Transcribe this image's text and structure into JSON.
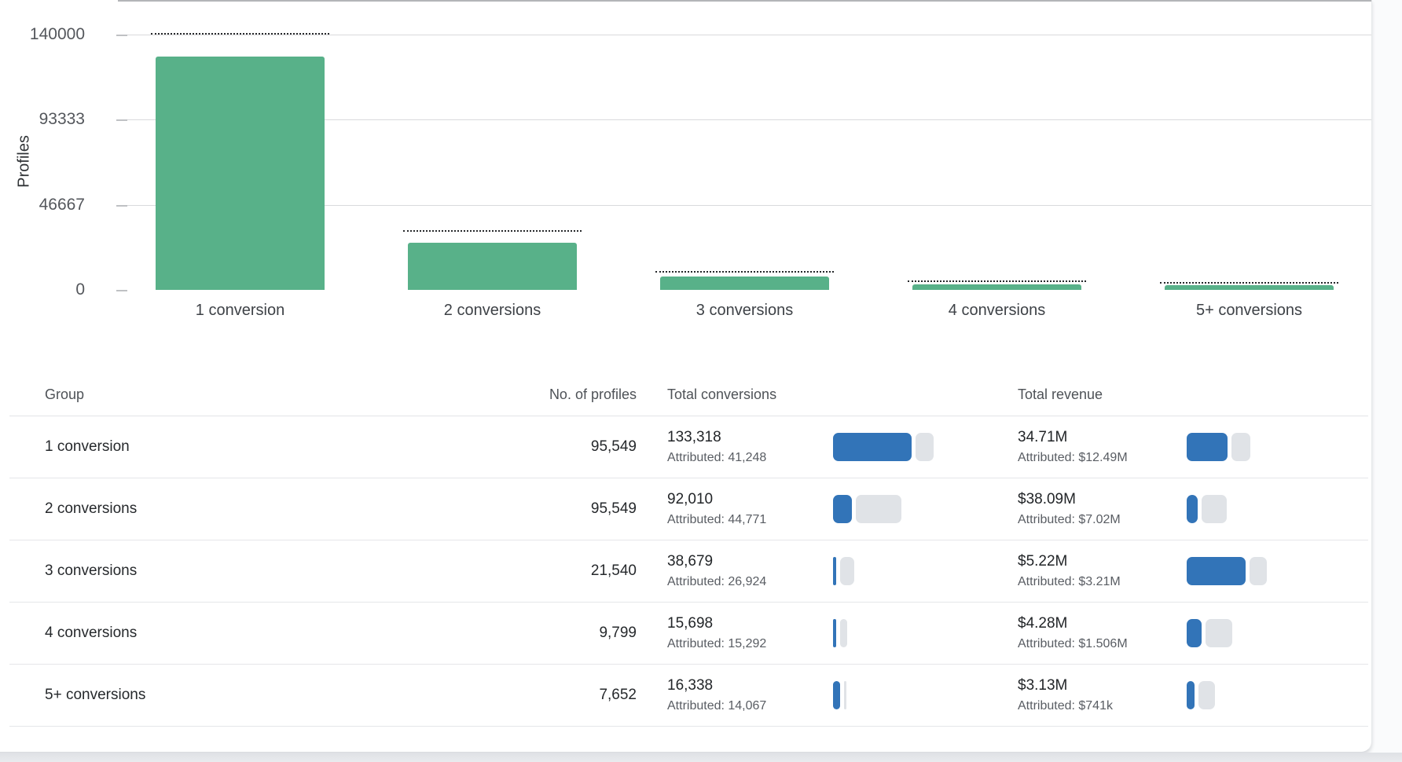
{
  "chart_data": {
    "type": "bar",
    "title": "",
    "xlabel": "",
    "ylabel": "Profiles",
    "categories": [
      "1 conversion",
      "2 conversions",
      "3 conversions",
      "4 conversions",
      "5+ conversions"
    ],
    "series": [
      {
        "name": "profiles-bar",
        "values": [
          128000,
          26000,
          7400,
          3000,
          2600
        ]
      },
      {
        "name": "dotted-benchmark",
        "values": [
          140000,
          32000,
          9500,
          4300,
          3500
        ]
      }
    ],
    "yticks": [
      140000,
      93333,
      46667,
      0
    ],
    "ytick_labels": [
      "140000",
      "93333",
      "46667",
      "0"
    ],
    "ylim": [
      0,
      140000
    ],
    "grid": "horizontal",
    "legend": "none",
    "bar_color": "#58b189",
    "dotted_color": "#26282b"
  },
  "table": {
    "headers": {
      "group": "Group",
      "profiles": "No. of profiles",
      "conversions": "Total conversions",
      "revenue": "Total revenue"
    },
    "rows": [
      {
        "group": "1 conversion",
        "profiles": "95,549",
        "conv_total": "133,318",
        "conv_attr": "Attributed: 41,248",
        "conv_bar": [
          100,
          23
        ],
        "rev_total": "34.71M",
        "rev_attr": "Attributed: $12.49M",
        "rev_bar": [
          52,
          24
        ]
      },
      {
        "group": "2 conversions",
        "profiles": "95,549",
        "conv_total": "92,010",
        "conv_attr": "Attributed: 44,771",
        "conv_bar": [
          24,
          58
        ],
        "rev_total": "$38.09M",
        "rev_attr": "Attributed: $7.02M",
        "rev_bar": [
          14,
          32
        ]
      },
      {
        "group": "3 conversions",
        "profiles": "21,540",
        "conv_total": "38,679",
        "conv_attr": "Attributed: 26,924",
        "conv_bar": [
          4,
          18
        ],
        "rev_total": "$5.22M",
        "rev_attr": "Attributed: $3.21M",
        "rev_bar": [
          75,
          22
        ]
      },
      {
        "group": "4 conversions",
        "profiles": "9,799",
        "conv_total": "15,698",
        "conv_attr": "Attributed: 15,292",
        "conv_bar": [
          4,
          9
        ],
        "rev_total": "$4.28M",
        "rev_attr": "Attributed: $1.506M",
        "rev_bar": [
          19,
          34
        ]
      },
      {
        "group": "5+ conversions",
        "profiles": "7,652",
        "conv_total": "16,338",
        "conv_attr": "Attributed: 14,067",
        "conv_bar": [
          9,
          3
        ],
        "rev_total": "$3.13M",
        "rev_attr": "Attributed: $741k",
        "rev_bar": [
          10,
          21
        ]
      }
    ]
  },
  "colors": {
    "bar_green": "#58b189",
    "mini_bar_blue": "#3274b8",
    "mini_bar_track": "#e0e3e7",
    "gridline": "#d9dadc",
    "divider": "#e5e6e9"
  }
}
